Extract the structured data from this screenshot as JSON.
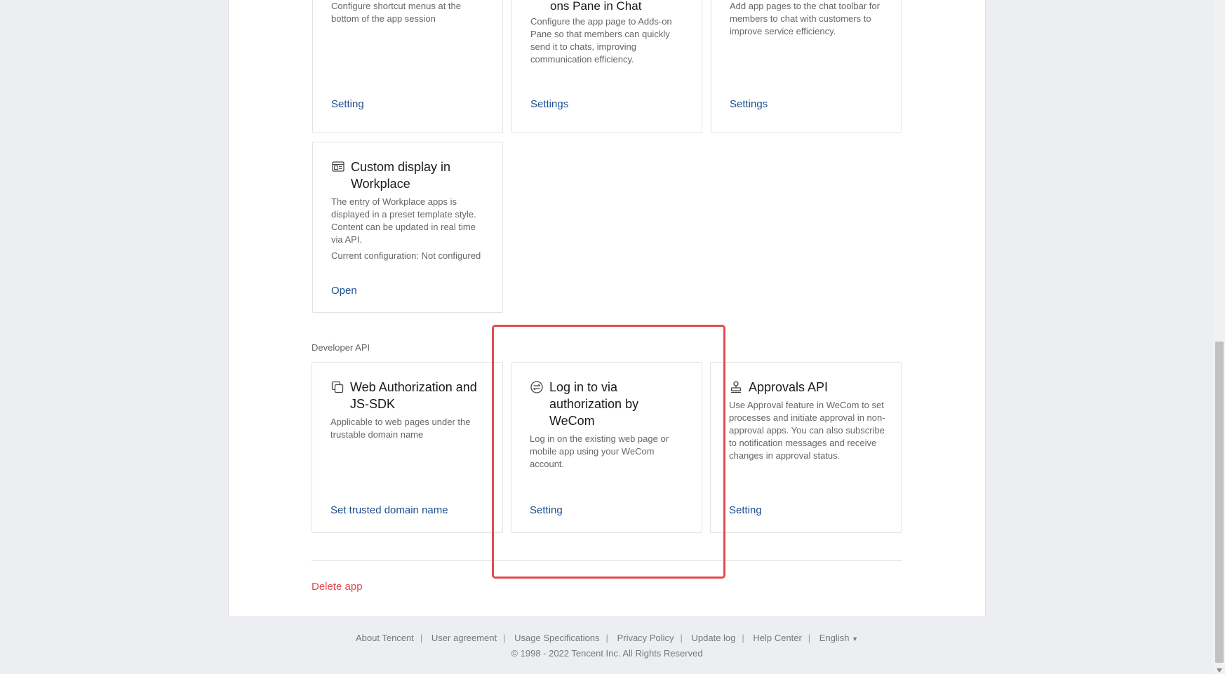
{
  "cards_top": [
    {
      "title_tail": "",
      "desc": "Configure shortcut menus at the bottom of the app session",
      "link": "Setting"
    },
    {
      "title_tail": "ons Pane in Chat",
      "desc": "Configure the app page to Adds-on Pane so that members can quickly send it to chats, improving communication efficiency.",
      "link": "Settings"
    },
    {
      "title_tail": "",
      "desc": "Add app pages to the chat toolbar for members to chat with customers to improve service efficiency.",
      "link": "Settings"
    }
  ],
  "custom_display": {
    "title": "Custom display in Workplace",
    "desc": "The entry of Workplace apps is displayed in a preset template style. Content can be updated in real time via API.",
    "config": "Current configuration: Not configured",
    "link": "Open",
    "icon": "template-icon"
  },
  "developer_api": {
    "label": "Developer API",
    "cards": [
      {
        "title": "Web Authorization and JS-SDK",
        "desc": "Applicable to web pages under the trustable domain name",
        "link": "Set trusted domain name",
        "icon": "copy-window-icon"
      },
      {
        "title": "Log in to via authorization by WeCom",
        "desc": "Log in on the existing web page or mobile app using your WeCom account.",
        "link": "Setting",
        "icon": "login-circle-icon"
      },
      {
        "title": "Approvals API",
        "desc": "Use Approval feature in WeCom to set processes and initiate approval in non-approval apps. You can also subscribe to notification messages and receive changes in approval status.",
        "link": "Setting",
        "icon": "stamp-icon"
      }
    ]
  },
  "delete_app": "Delete app",
  "footer": {
    "links": [
      "About Tencent",
      "User agreement",
      "Usage Specifications",
      "Privacy Policy",
      "Update log",
      "Help Center"
    ],
    "language": "English",
    "language_caret": "▼",
    "copyright": "© 1998 - 2022 Tencent Inc. All Rights Reserved"
  },
  "colors": {
    "link": "#1d4f91",
    "danger": "#e5484d",
    "highlight": "#e34b50"
  }
}
